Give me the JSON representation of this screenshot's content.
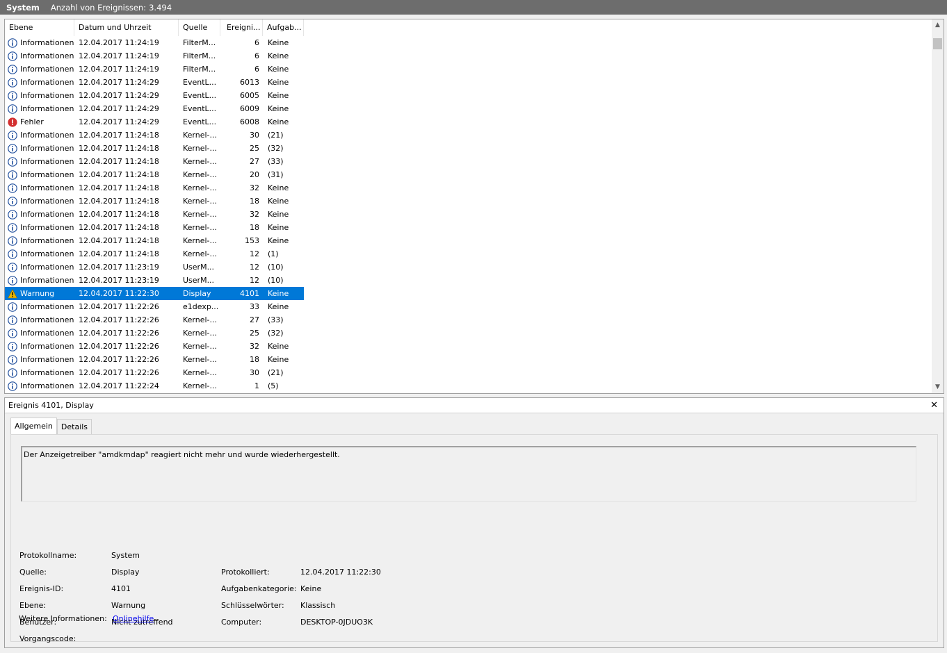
{
  "titlebar": {
    "name": "System",
    "count_label": "Anzahl von Ereignissen:",
    "count_value": "3.494"
  },
  "columns": {
    "level": "Ebene",
    "datetime": "Datum und Uhrzeit",
    "source": "Quelle",
    "event_id": "Ereigni...",
    "task": "Aufgab..."
  },
  "events": [
    {
      "level": "Informationen",
      "icon": "info-icon",
      "datetime": "12.04.2017 11:24:19",
      "source": "FilterM...",
      "id": "6",
      "task": "Keine"
    },
    {
      "level": "Informationen",
      "icon": "info-icon",
      "datetime": "12.04.2017 11:24:19",
      "source": "FilterM...",
      "id": "6",
      "task": "Keine"
    },
    {
      "level": "Informationen",
      "icon": "info-icon",
      "datetime": "12.04.2017 11:24:19",
      "source": "FilterM...",
      "id": "6",
      "task": "Keine"
    },
    {
      "level": "Informationen",
      "icon": "info-icon",
      "datetime": "12.04.2017 11:24:29",
      "source": "EventL...",
      "id": "6013",
      "task": "Keine"
    },
    {
      "level": "Informationen",
      "icon": "info-icon",
      "datetime": "12.04.2017 11:24:29",
      "source": "EventL...",
      "id": "6005",
      "task": "Keine"
    },
    {
      "level": "Informationen",
      "icon": "info-icon",
      "datetime": "12.04.2017 11:24:29",
      "source": "EventL...",
      "id": "6009",
      "task": "Keine"
    },
    {
      "level": "Fehler",
      "icon": "error-icon",
      "datetime": "12.04.2017 11:24:29",
      "source": "EventL...",
      "id": "6008",
      "task": "Keine"
    },
    {
      "level": "Informationen",
      "icon": "info-icon",
      "datetime": "12.04.2017 11:24:18",
      "source": "Kernel-...",
      "id": "30",
      "task": "(21)"
    },
    {
      "level": "Informationen",
      "icon": "info-icon",
      "datetime": "12.04.2017 11:24:18",
      "source": "Kernel-...",
      "id": "25",
      "task": "(32)"
    },
    {
      "level": "Informationen",
      "icon": "info-icon",
      "datetime": "12.04.2017 11:24:18",
      "source": "Kernel-...",
      "id": "27",
      "task": "(33)"
    },
    {
      "level": "Informationen",
      "icon": "info-icon",
      "datetime": "12.04.2017 11:24:18",
      "source": "Kernel-...",
      "id": "20",
      "task": "(31)"
    },
    {
      "level": "Informationen",
      "icon": "info-icon",
      "datetime": "12.04.2017 11:24:18",
      "source": "Kernel-...",
      "id": "32",
      "task": "Keine"
    },
    {
      "level": "Informationen",
      "icon": "info-icon",
      "datetime": "12.04.2017 11:24:18",
      "source": "Kernel-...",
      "id": "18",
      "task": "Keine"
    },
    {
      "level": "Informationen",
      "icon": "info-icon",
      "datetime": "12.04.2017 11:24:18",
      "source": "Kernel-...",
      "id": "32",
      "task": "Keine"
    },
    {
      "level": "Informationen",
      "icon": "info-icon",
      "datetime": "12.04.2017 11:24:18",
      "source": "Kernel-...",
      "id": "18",
      "task": "Keine"
    },
    {
      "level": "Informationen",
      "icon": "info-icon",
      "datetime": "12.04.2017 11:24:18",
      "source": "Kernel-...",
      "id": "153",
      "task": "Keine"
    },
    {
      "level": "Informationen",
      "icon": "info-icon",
      "datetime": "12.04.2017 11:24:18",
      "source": "Kernel-...",
      "id": "12",
      "task": "(1)"
    },
    {
      "level": "Informationen",
      "icon": "info-icon",
      "datetime": "12.04.2017 11:23:19",
      "source": "UserM...",
      "id": "12",
      "task": "(10)"
    },
    {
      "level": "Informationen",
      "icon": "info-icon",
      "datetime": "12.04.2017 11:23:19",
      "source": "UserM...",
      "id": "12",
      "task": "(10)"
    },
    {
      "level": "Warnung",
      "icon": "warning-icon",
      "datetime": "12.04.2017 11:22:30",
      "source": "Display",
      "id": "4101",
      "task": "Keine",
      "selected": true
    },
    {
      "level": "Informationen",
      "icon": "info-icon",
      "datetime": "12.04.2017 11:22:26",
      "source": "e1dexp...",
      "id": "33",
      "task": "Keine"
    },
    {
      "level": "Informationen",
      "icon": "info-icon",
      "datetime": "12.04.2017 11:22:26",
      "source": "Kernel-...",
      "id": "27",
      "task": "(33)"
    },
    {
      "level": "Informationen",
      "icon": "info-icon",
      "datetime": "12.04.2017 11:22:26",
      "source": "Kernel-...",
      "id": "25",
      "task": "(32)"
    },
    {
      "level": "Informationen",
      "icon": "info-icon",
      "datetime": "12.04.2017 11:22:26",
      "source": "Kernel-...",
      "id": "32",
      "task": "Keine"
    },
    {
      "level": "Informationen",
      "icon": "info-icon",
      "datetime": "12.04.2017 11:22:26",
      "source": "Kernel-...",
      "id": "18",
      "task": "Keine"
    },
    {
      "level": "Informationen",
      "icon": "info-icon",
      "datetime": "12.04.2017 11:22:26",
      "source": "Kernel-...",
      "id": "30",
      "task": "(21)"
    },
    {
      "level": "Informationen",
      "icon": "info-icon",
      "datetime": "12.04.2017 11:22:24",
      "source": "Kernel-...",
      "id": "1",
      "task": "(5)"
    }
  ],
  "details": {
    "title": "Ereignis 4101, Display",
    "close_label": "✕",
    "tabs": [
      "Allgemein",
      "Details"
    ],
    "message": "Der Anzeigetreiber \"amdkmdap\" reagiert nicht mehr und wurde wiederhergestellt.",
    "fields": {
      "log_name_label": "Protokollname:",
      "log_name": "System",
      "source_label": "Quelle:",
      "source": "Display",
      "logged_label": "Protokolliert:",
      "logged": "12.04.2017 11:22:30",
      "event_id_label": "Ereignis-ID:",
      "event_id": "4101",
      "task_category_label": "Aufgabenkategorie:",
      "task_category": "Keine",
      "level_label": "Ebene:",
      "level": "Warnung",
      "keywords_label": "Schlüsselwörter:",
      "keywords": "Klassisch",
      "user_label": "Benutzer:",
      "user": "Nicht zutreffend",
      "computer_label": "Computer:",
      "computer": "DESKTOP-0JDUO3K",
      "opcode_label": "Vorgangscode:",
      "more_info_label": "Weitere Informationen:",
      "more_info_link": "Onlinehilfe"
    }
  },
  "colors": {
    "selection": "#0078d7",
    "titlebar": "#6d6d6d",
    "info": "#1f4e9c",
    "error": "#d32f2f",
    "warning": "#e8b500"
  }
}
